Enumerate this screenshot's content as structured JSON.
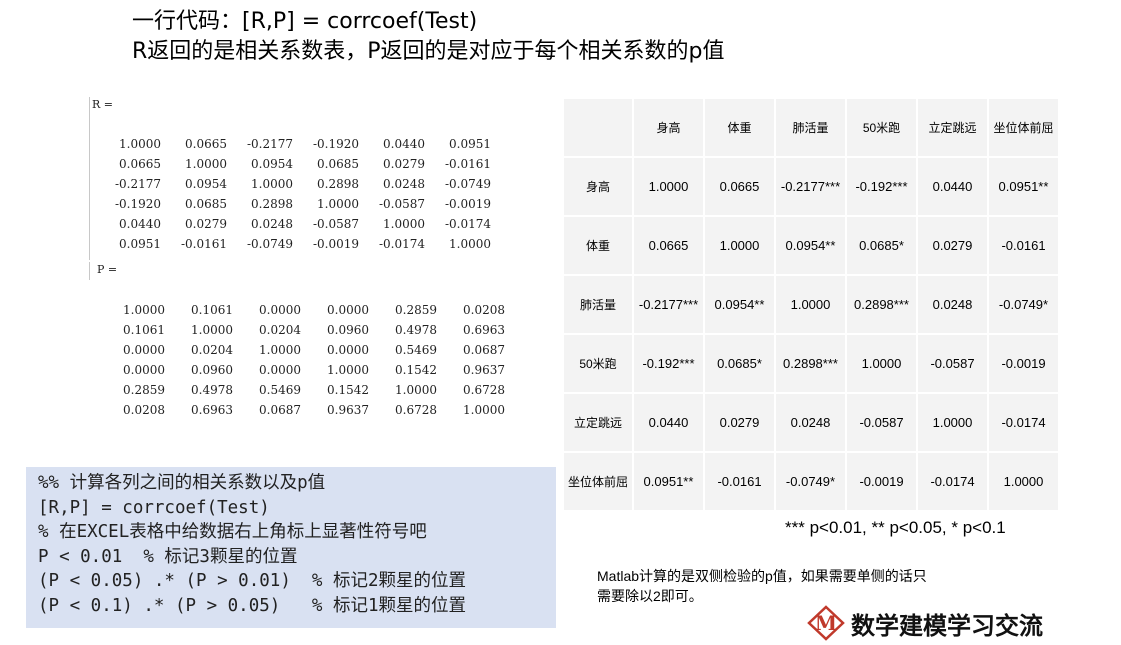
{
  "title_line1": "一行代码：[R,P] = corrcoef(Test)",
  "title_line2": "R返回的是相关系数表，P返回的是对应于每个相关系数的p值",
  "r_label": "R =",
  "p_label": "P =",
  "r_matrix": [
    [
      "1.0000",
      "0.0665",
      "-0.2177",
      "-0.1920",
      "0.0440",
      "0.0951"
    ],
    [
      "0.0665",
      "1.0000",
      "0.0954",
      "0.0685",
      "0.0279",
      "-0.0161"
    ],
    [
      "-0.2177",
      "0.0954",
      "1.0000",
      "0.2898",
      "0.0248",
      "-0.0749"
    ],
    [
      "-0.1920",
      "0.0685",
      "0.2898",
      "1.0000",
      "-0.0587",
      "-0.0019"
    ],
    [
      "0.0440",
      "0.0279",
      "0.0248",
      "-0.0587",
      "1.0000",
      "-0.0174"
    ],
    [
      "0.0951",
      "-0.0161",
      "-0.0749",
      "-0.0019",
      "-0.0174",
      "1.0000"
    ]
  ],
  "p_matrix": [
    [
      "1.0000",
      "0.1061",
      "0.0000",
      "0.0000",
      "0.2859",
      "0.0208"
    ],
    [
      "0.1061",
      "1.0000",
      "0.0204",
      "0.0960",
      "0.4978",
      "0.6963"
    ],
    [
      "0.0000",
      "0.0204",
      "1.0000",
      "0.0000",
      "0.5469",
      "0.0687"
    ],
    [
      "0.0000",
      "0.0960",
      "0.0000",
      "1.0000",
      "0.1542",
      "0.9637"
    ],
    [
      "0.2859",
      "0.4978",
      "0.5469",
      "0.1542",
      "1.0000",
      "0.6728"
    ],
    [
      "0.0208",
      "0.6963",
      "0.0687",
      "0.9637",
      "0.6728",
      "1.0000"
    ]
  ],
  "code_lines": [
    "%% 计算各列之间的相关系数以及p值",
    "[R,P] = corrcoef(Test)",
    "% 在EXCEL表格中给数据右上角标上显著性符号吧",
    "P < 0.01  % 标记3颗星的位置",
    "(P < 0.05) .* (P > 0.01)  % 标记2颗星的位置",
    "(P < 0.1) .* (P > 0.05)   % 标记1颗星的位置"
  ],
  "table": {
    "headers": [
      "",
      "身高",
      "体重",
      "肺活量",
      "50米跑",
      "立定跳远",
      "坐位体前屈"
    ],
    "rows": [
      [
        "身高",
        "1.0000",
        "0.0665",
        "-0.2177***",
        "-0.192***",
        "0.0440",
        "0.0951**"
      ],
      [
        "体重",
        "0.0665",
        "1.0000",
        "0.0954**",
        "0.0685*",
        "0.0279",
        "-0.0161"
      ],
      [
        "肺活量",
        "-0.2177***",
        "0.0954**",
        "1.0000",
        "0.2898***",
        "0.0248",
        "-0.0749*"
      ],
      [
        "50米跑",
        "-0.192***",
        "0.0685*",
        "0.2898***",
        "1.0000",
        "-0.0587",
        "-0.0019"
      ],
      [
        "立定跳远",
        "0.0440",
        "0.0279",
        "0.0248",
        "-0.0587",
        "1.0000",
        "-0.0174"
      ],
      [
        "坐位体前屈",
        "0.0951**",
        "-0.0161",
        "-0.0749*",
        "-0.0019",
        "-0.0174",
        "1.0000"
      ]
    ]
  },
  "significance_note": "*** p<0.01, ** p<0.05, * p<0.1",
  "matlab_note_line1": "Matlab计算的是双侧检验的p值，如果需要单侧的话只",
  "matlab_note_line2": "需要除以2即可。",
  "logo_letter": "M",
  "logo_text": "数学建模学习交流",
  "colors": {
    "code_bg": "#d9e1f2",
    "table_bg": "#f3f3f3",
    "logo_red": "#c0392b"
  }
}
